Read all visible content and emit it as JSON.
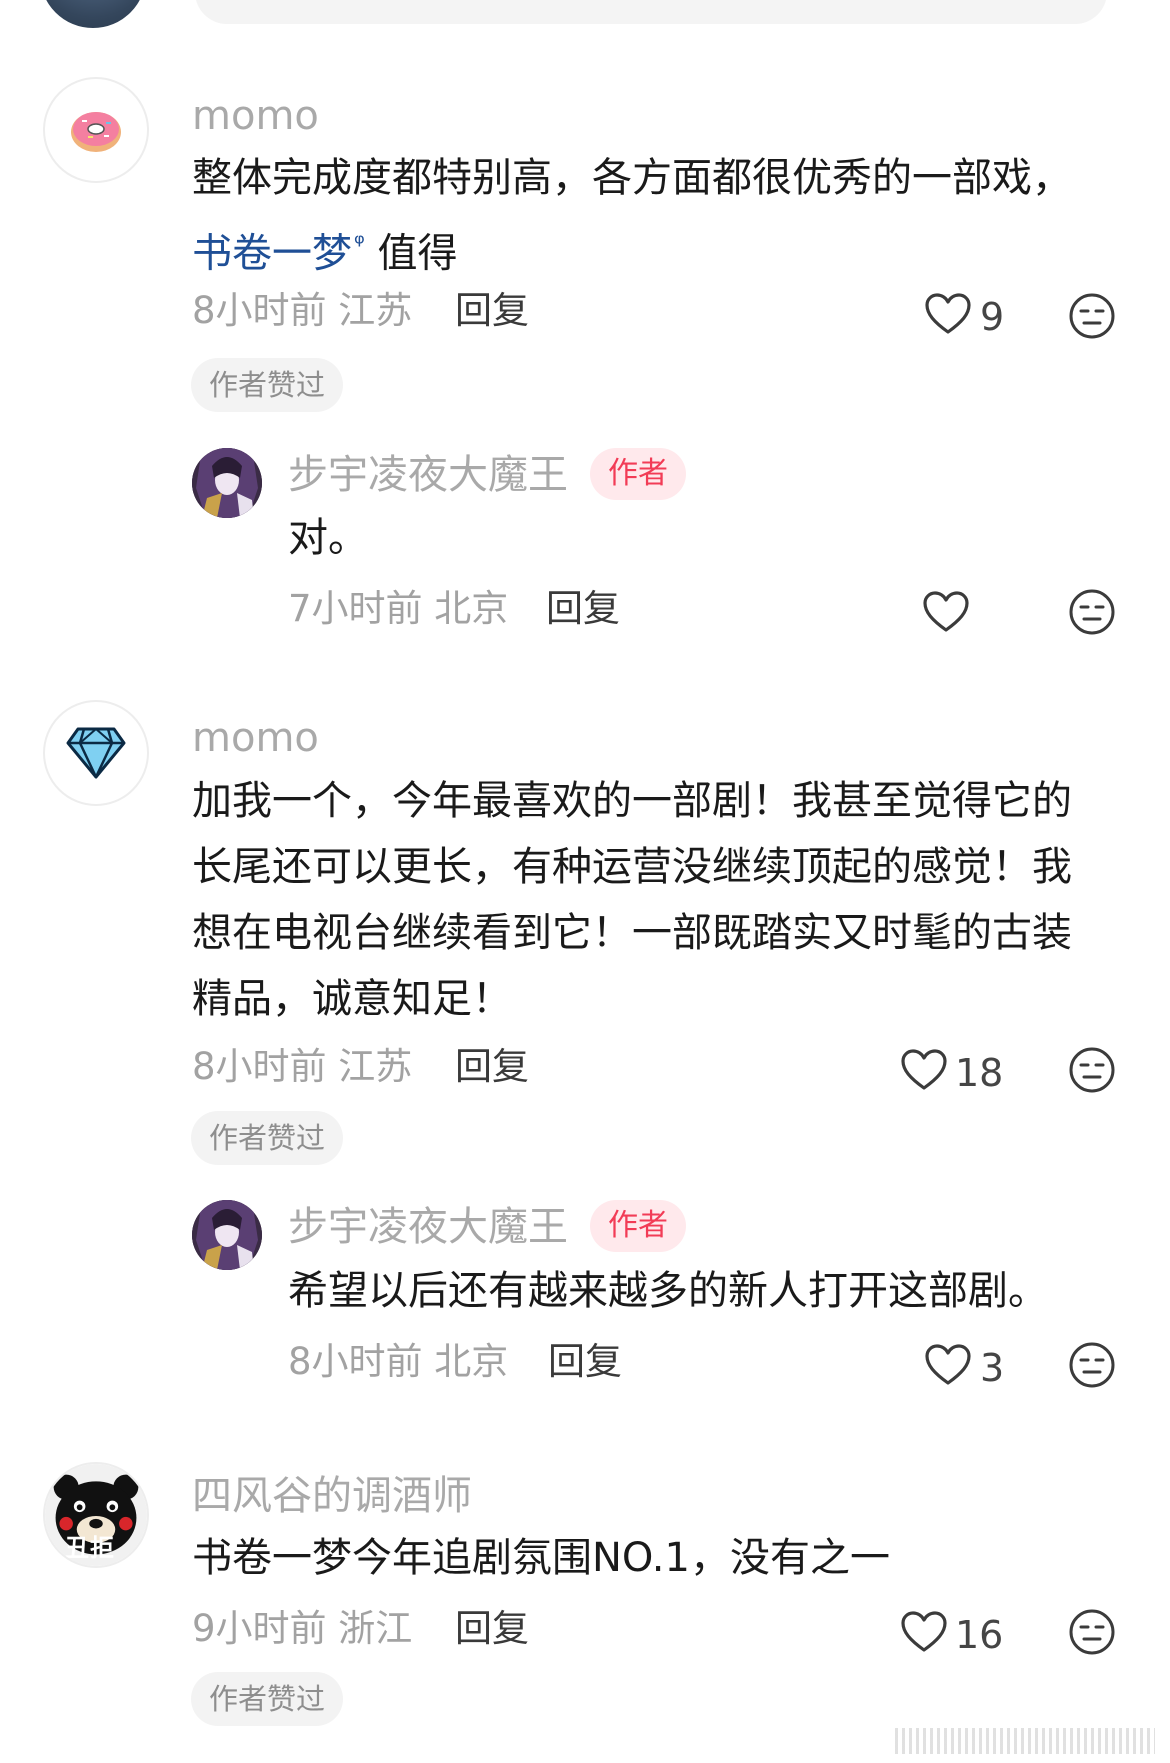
{
  "comments": [
    {
      "username": "momo",
      "text": "整体完成度都特别高，各方面都很优秀的一部戏，",
      "link_text": "书卷一梦",
      "text_after_link": "值得",
      "meta": "8小时前 江苏",
      "reply_label": "回复",
      "likes": "9",
      "liked_badge": "作者赞过",
      "avatar_icon": "donut-icon",
      "reply_item": {
        "username": "步宇凌夜大魔王",
        "badge": "作者",
        "text": "对。",
        "meta": "7小时前 北京",
        "reply_label": "回复",
        "likes": ""
      }
    },
    {
      "username": "momo",
      "text": "加我一个，今年最喜欢的一部剧！我甚至觉得它的长尾还可以更长，有种运营没继续顶起的感觉！我想在电视台继续看到它！一部既踏实又时髦的古装精品，诚意知足！",
      "meta": "8小时前 江苏",
      "reply_label": "回复",
      "likes": "18",
      "liked_badge": "作者赞过",
      "avatar_icon": "diamond-icon",
      "reply_item": {
        "username": "步宇凌夜大魔王",
        "badge": "作者",
        "text": "希望以后还有越来越多的新人打开这部剧。",
        "meta": "8小时前 北京",
        "reply_label": "回复",
        "likes": "3"
      }
    },
    {
      "username": "四风谷的调酒师",
      "text": "书卷一梦今年追剧氛围NO.1，没有之一",
      "meta": "9小时前 浙江",
      "reply_label": "回复",
      "likes": "16",
      "liked_badge": "作者赞过",
      "avatar_icon": "bear-icon",
      "avatar_text": "丑拒"
    }
  ],
  "colors": {
    "link": "#1f4f96",
    "author_badge_text": "#f23c56",
    "author_badge_bg": "#ffe9ec",
    "meta_gray": "#a2a2a2"
  }
}
